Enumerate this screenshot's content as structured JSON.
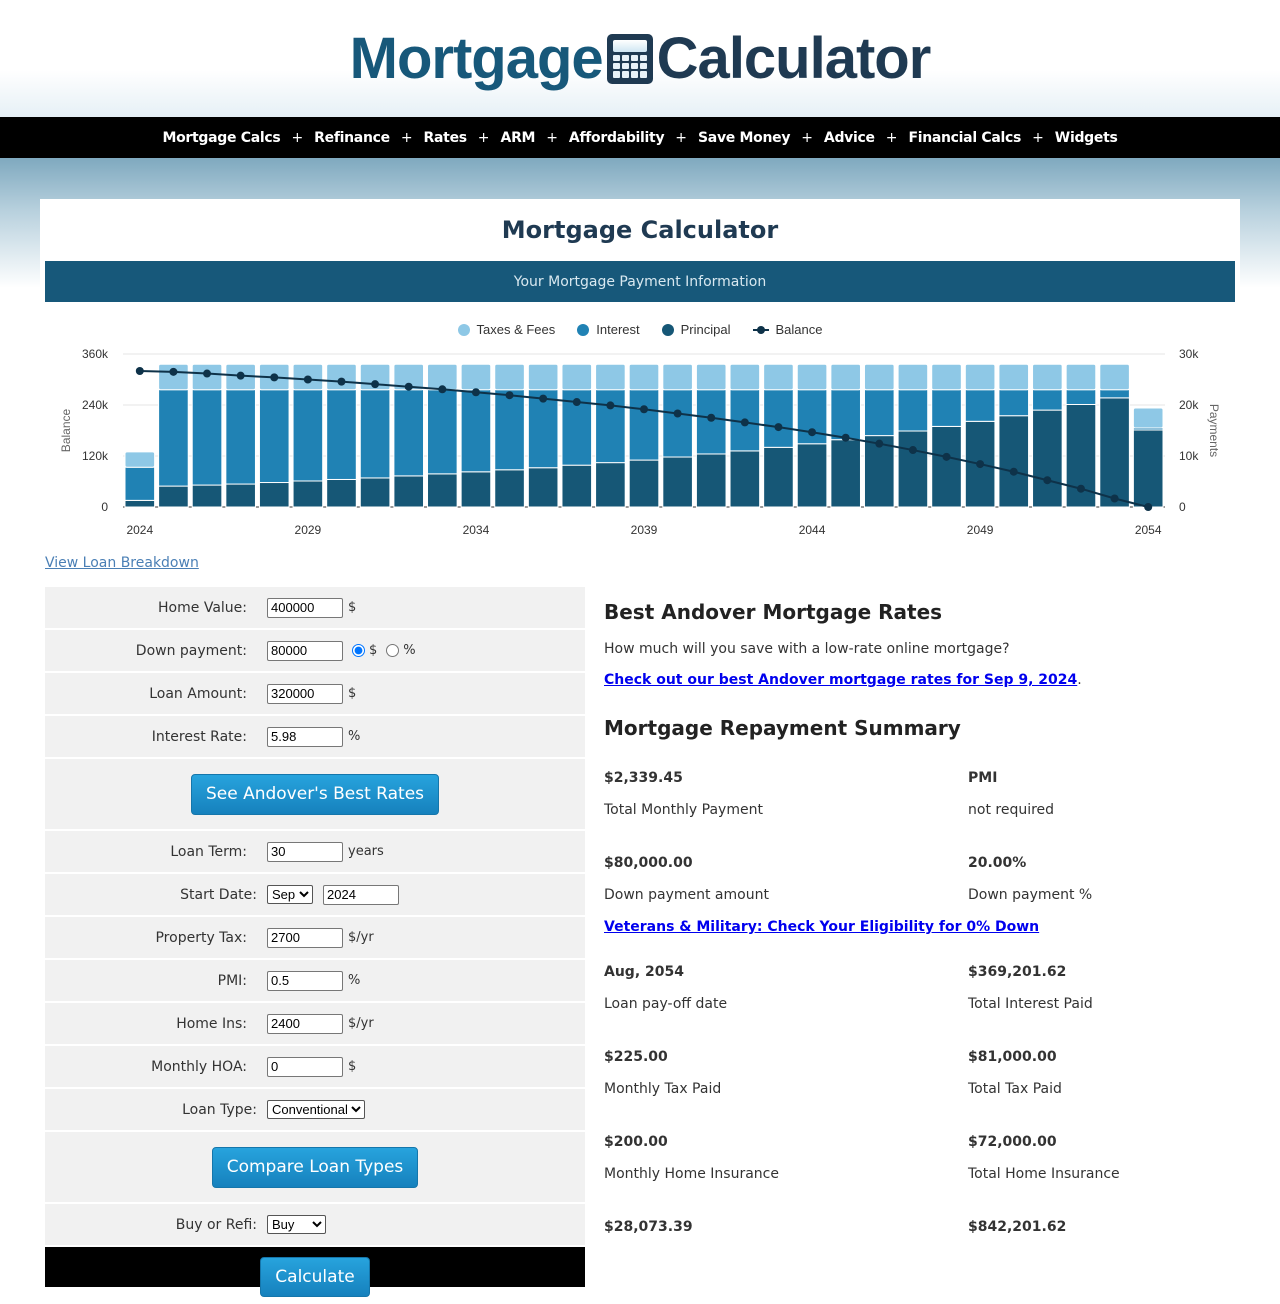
{
  "header": {
    "logo_part1": "Mortgage",
    "logo_part2": "Calculator"
  },
  "nav": {
    "items": [
      "Mortgage Calcs",
      "Refinance",
      "Rates",
      "ARM",
      "Affordability",
      "Save Money",
      "Advice",
      "Financial Calcs",
      "Widgets"
    ],
    "separator": "+"
  },
  "page": {
    "title": "Mortgage Calculator",
    "section_header": "Your Mortgage Payment Information",
    "breakdown_link": "View Loan Breakdown"
  },
  "colors": {
    "taxes": "#8ec8e6",
    "interest": "#2082b4",
    "principal": "#165776",
    "balance": "#0e3249",
    "accent": "#17587a"
  },
  "chart_data": {
    "type": "bar",
    "stacked": true,
    "legend": [
      "Taxes & Fees",
      "Interest",
      "Principal",
      "Balance"
    ],
    "legend_position": "top",
    "categories": [
      "2024",
      "2025",
      "2026",
      "2027",
      "2028",
      "2029",
      "2030",
      "2031",
      "2032",
      "2033",
      "2034",
      "2035",
      "2036",
      "2037",
      "2038",
      "2039",
      "2040",
      "2041",
      "2042",
      "2043",
      "2044",
      "2045",
      "2046",
      "2047",
      "2048",
      "2049",
      "2050",
      "2051",
      "2052",
      "2053",
      "2054"
    ],
    "x_tick_labels": [
      "2024",
      "2029",
      "2034",
      "2039",
      "2044",
      "2049",
      "2054"
    ],
    "series": [
      {
        "name": "Principal",
        "axis": "right",
        "values": [
          1.3,
          4.1,
          4.3,
          4.5,
          4.8,
          5.1,
          5.4,
          5.7,
          6.1,
          6.5,
          6.9,
          7.3,
          7.7,
          8.2,
          8.7,
          9.2,
          9.8,
          10.4,
          11.0,
          11.7,
          12.4,
          13.2,
          14.0,
          14.9,
          15.8,
          16.8,
          17.9,
          19.0,
          20.1,
          21.4,
          15.1
        ]
      },
      {
        "name": "Interest",
        "axis": "right",
        "values": [
          6.5,
          18.9,
          18.7,
          18.5,
          18.2,
          17.9,
          17.6,
          17.3,
          16.9,
          16.5,
          16.1,
          15.7,
          15.3,
          14.8,
          14.3,
          13.8,
          13.2,
          12.6,
          12.0,
          11.3,
          10.6,
          9.8,
          9.0,
          8.1,
          7.2,
          6.2,
          5.1,
          4.0,
          2.9,
          1.6,
          0.4
        ]
      },
      {
        "name": "Taxes & Fees",
        "axis": "right",
        "values": [
          3.0,
          5.0,
          5.0,
          5.0,
          5.0,
          5.0,
          5.0,
          5.0,
          5.0,
          5.0,
          5.0,
          5.0,
          5.0,
          5.0,
          5.0,
          5.0,
          5.0,
          5.0,
          5.0,
          5.0,
          5.0,
          5.0,
          5.0,
          5.0,
          5.0,
          5.0,
          5.0,
          5.0,
          5.0,
          5.0,
          3.9
        ]
      },
      {
        "name": "Balance",
        "type": "line",
        "axis": "left",
        "values": [
          320,
          318,
          314,
          309,
          305,
          300,
          295,
          289,
          283,
          277,
          270,
          263,
          255,
          247,
          239,
          230,
          220,
          210,
          199,
          188,
          176,
          163,
          149,
          134,
          118,
          101,
          83,
          63,
          43,
          20,
          0
        ]
      }
    ],
    "y_left": {
      "label": "Balance",
      "ticks": [
        "0",
        "120k",
        "240k",
        "360k"
      ],
      "range": [
        0,
        360
      ],
      "unit": "thousands"
    },
    "y_right": {
      "label": "Payments",
      "ticks": [
        "0",
        "10k",
        "20k",
        "30k"
      ],
      "range": [
        0,
        30
      ],
      "unit": "thousands"
    },
    "grid": true
  },
  "form": {
    "home_value": {
      "label": "Home Value:",
      "value": "400000",
      "unit": "$"
    },
    "down_payment": {
      "label": "Down payment:",
      "value": "80000",
      "radio_dollar": "$",
      "radio_percent": "%",
      "selected": "$"
    },
    "loan_amount": {
      "label": "Loan Amount:",
      "value": "320000",
      "unit": "$"
    },
    "interest_rate": {
      "label": "Interest Rate:",
      "value": "5.98",
      "unit": "%"
    },
    "rates_button": "See Andover's Best Rates",
    "loan_term": {
      "label": "Loan Term:",
      "value": "30",
      "unit": "years"
    },
    "start_date": {
      "label": "Start Date:",
      "month": "Sep",
      "year": "2024"
    },
    "property_tax": {
      "label": "Property Tax:",
      "value": "2700",
      "unit": "$/yr"
    },
    "pmi": {
      "label": "PMI:",
      "value": "0.5",
      "unit": "%"
    },
    "home_ins": {
      "label": "Home Ins:",
      "value": "2400",
      "unit": "$/yr"
    },
    "hoa": {
      "label": "Monthly HOA:",
      "value": "0",
      "unit": "$"
    },
    "loan_type": {
      "label": "Loan Type:",
      "value": "Conventional"
    },
    "compare_button": "Compare Loan Types",
    "buy_refi": {
      "label": "Buy or Refi:",
      "value": "Buy"
    },
    "calculate_button": "Calculate"
  },
  "summary": {
    "rates_heading": "Best Andover Mortgage Rates",
    "rates_text": "How much will you save with a low-rate online mortgage?",
    "rates_link": "Check out our best Andover mortgage rates for Sep 9, 2024",
    "rates_link_suffix": ".",
    "repayment_heading": "Mortgage Repayment Summary",
    "veterans_link": "Veterans & Military: Check Your Eligibility for 0% Down",
    "block1": [
      {
        "value": "$2,339.45",
        "desc": "Total Monthly Payment"
      },
      {
        "value": "PMI",
        "desc": "not required"
      },
      {
        "value": "$80,000.00",
        "desc": "Down payment amount"
      },
      {
        "value": "20.00%",
        "desc": "Down payment %"
      }
    ],
    "block2": [
      {
        "value": "Aug, 2054",
        "desc": "Loan pay-off date"
      },
      {
        "value": "$369,201.62",
        "desc": "Total Interest Paid"
      },
      {
        "value": "$225.00",
        "desc": "Monthly Tax Paid"
      },
      {
        "value": "$81,000.00",
        "desc": "Total Tax Paid"
      },
      {
        "value": "$200.00",
        "desc": "Monthly Home Insurance"
      },
      {
        "value": "$72,000.00",
        "desc": "Total Home Insurance"
      },
      {
        "value": "$28,073.39",
        "desc": ""
      },
      {
        "value": "$842,201.62",
        "desc": ""
      }
    ]
  }
}
